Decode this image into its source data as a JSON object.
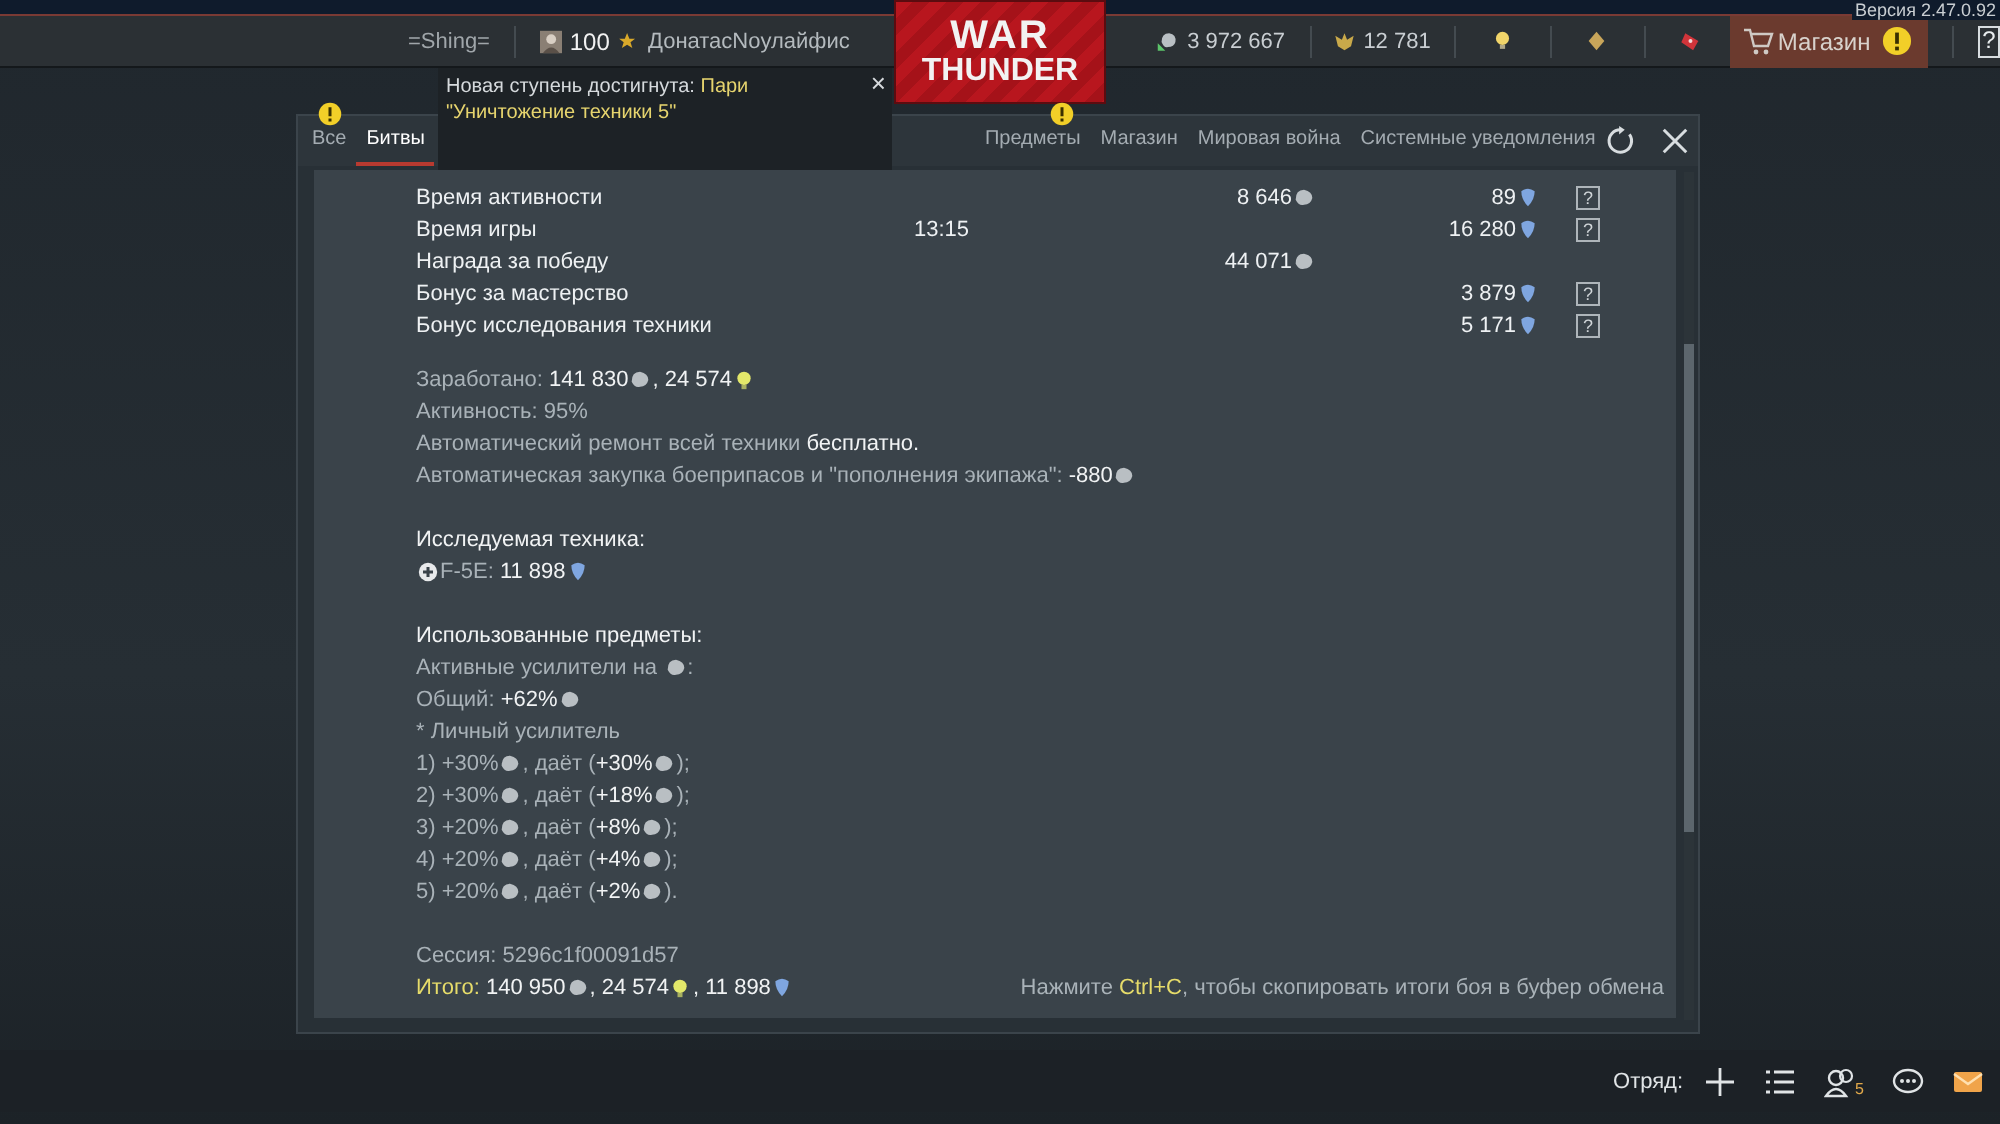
{
  "version": "Версия 2.47.0.92",
  "topbar": {
    "clan": "=Shing=",
    "level": "100",
    "nickname": "ДонатасNoулайфис",
    "logo": [
      "WAR",
      "THUNDER"
    ],
    "coins": "3 972 667",
    "eagles": "12 781",
    "shop": "Магазин",
    "help": "?"
  },
  "notification": {
    "label": "Новая ступень достигнута: ",
    "highlight": "Пари \"Уничтожение техники 5\"",
    "close": "×"
  },
  "tabs": [
    {
      "label": "Все",
      "selected": false,
      "alert": true
    },
    {
      "label": "Битвы",
      "selected": true,
      "alert": false
    },
    {
      "label": "Предметы",
      "selected": false,
      "alert": true
    },
    {
      "label": "Магазин",
      "selected": false,
      "alert": false
    },
    {
      "label": "Мировая война",
      "selected": false,
      "alert": false
    },
    {
      "label": "Системные уведомления",
      "selected": false,
      "alert": false
    }
  ],
  "rows": [
    {
      "name": "Время активности",
      "coins": "8 646",
      "rp": "89",
      "help": "?"
    },
    {
      "name": "Время игры",
      "time": "13:15",
      "rp": "16 280",
      "help": "?"
    },
    {
      "name": "Награда за победу",
      "coins": "44 071"
    },
    {
      "name": "Бонус за мастерство",
      "rp": "3 879",
      "help": "?"
    },
    {
      "name": "Бонус исследования техники",
      "rp": "5 171",
      "help": "?"
    }
  ],
  "blocks": [
    [
      [
        {
          "kind": "dim",
          "text": "Заработано: "
        },
        {
          "kind": "bright",
          "text": "141 830"
        },
        {
          "kind": "silver"
        },
        {
          "kind": "bright",
          "text": ", 24 574"
        },
        {
          "kind": "bulb"
        }
      ],
      [
        {
          "kind": "dim",
          "text": "Активность: 95%"
        }
      ],
      [
        {
          "kind": "dim",
          "text": "Автоматический ремонт всей техники "
        },
        {
          "kind": "bright",
          "text": "бесплатно."
        }
      ],
      [
        {
          "kind": "dim",
          "text": "Автоматическая закупка боеприпасов и \"пополнения экипажа\": "
        },
        {
          "kind": "bright",
          "text": "-880"
        },
        {
          "kind": "silver"
        }
      ]
    ],
    [
      [
        {
          "kind": "bright",
          "text": "Исследуемая техника:"
        }
      ],
      [
        {
          "kind": "vehicle"
        },
        {
          "kind": "dim",
          "text": "F-5E: "
        },
        {
          "kind": "bright",
          "text": "11 898"
        },
        {
          "kind": "rp"
        }
      ]
    ],
    [
      [
        {
          "kind": "bright",
          "text": "Использованные предметы:"
        }
      ],
      [
        {
          "kind": "dim",
          "text": "Активные усилители на "
        },
        {
          "kind": "silver"
        },
        {
          "kind": "dim",
          "text": ":"
        }
      ],
      [
        {
          "kind": "dim",
          "text": "Общий: "
        },
        {
          "kind": "bright",
          "text": "+62%"
        },
        {
          "kind": "silver"
        }
      ],
      [
        {
          "kind": "dim",
          "text": "* Личный усилитель"
        }
      ],
      [
        {
          "kind": "dim",
          "text": "1) +30%"
        },
        {
          "kind": "silver"
        },
        {
          "kind": "dim",
          "text": ", даёт ("
        },
        {
          "kind": "bright",
          "text": "+30%"
        },
        {
          "kind": "silver"
        },
        {
          "kind": "dim",
          "text": ");"
        }
      ],
      [
        {
          "kind": "dim",
          "text": "2) +30%"
        },
        {
          "kind": "silver"
        },
        {
          "kind": "dim",
          "text": ", даёт ("
        },
        {
          "kind": "bright",
          "text": "+18%"
        },
        {
          "kind": "silver"
        },
        {
          "kind": "dim",
          "text": ");"
        }
      ],
      [
        {
          "kind": "dim",
          "text": "3) +20%"
        },
        {
          "kind": "silver"
        },
        {
          "kind": "dim",
          "text": ", даёт ("
        },
        {
          "kind": "bright",
          "text": "+8%"
        },
        {
          "kind": "silver"
        },
        {
          "kind": "dim",
          "text": ");"
        }
      ],
      [
        {
          "kind": "dim",
          "text": "4) +20%"
        },
        {
          "kind": "silver"
        },
        {
          "kind": "dim",
          "text": ", даёт ("
        },
        {
          "kind": "bright",
          "text": "+4%"
        },
        {
          "kind": "silver"
        },
        {
          "kind": "dim",
          "text": ");"
        }
      ],
      [
        {
          "kind": "dim",
          "text": "5) +20%"
        },
        {
          "kind": "silver"
        },
        {
          "kind": "dim",
          "text": ", даёт ("
        },
        {
          "kind": "bright",
          "text": "+2%"
        },
        {
          "kind": "silver"
        },
        {
          "kind": "dim",
          "text": ")."
        }
      ]
    ],
    [
      [
        {
          "kind": "dim",
          "text": "Сессия: 5296c1f00091d57"
        }
      ],
      [
        {
          "kind": "accent",
          "text": "Итого: "
        },
        {
          "kind": "bright",
          "text": "140 950"
        },
        {
          "kind": "silver"
        },
        {
          "kind": "bright",
          "text": ", 24 574"
        },
        {
          "kind": "bulb"
        },
        {
          "kind": "bright",
          "text": ", 11 898"
        },
        {
          "kind": "rp"
        }
      ]
    ]
  ],
  "copy_hint": [
    {
      "kind": "dim",
      "text": "Нажмите "
    },
    {
      "kind": "accent",
      "text": "Ctrl+C"
    },
    {
      "kind": "dim",
      "text": ", чтобы скопировать итоги боя в буфер обмена"
    }
  ],
  "bottombar": {
    "squad": "Отряд:",
    "friends_count": "5"
  }
}
